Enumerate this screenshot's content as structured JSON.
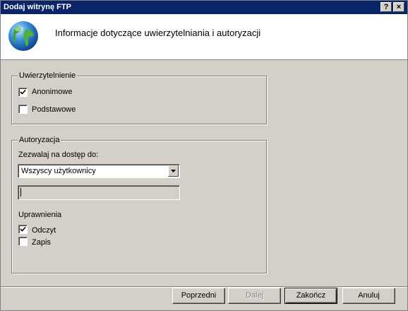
{
  "window": {
    "title": "Dodaj witrynę FTP",
    "help_label": "?",
    "close_label": "×"
  },
  "header": {
    "title": "Informacje dotyczące uwierzytelniania i autoryzacji",
    "icon": "globe-icon"
  },
  "authentication": {
    "legend": "Uwierzytelnienie",
    "anonymous": {
      "label": "Anonimowe",
      "checked": true
    },
    "basic": {
      "label": "Podstawowe",
      "checked": false
    }
  },
  "authorization": {
    "legend": "Autoryzacja",
    "allow_label": "Zezwalaj na dostęp do:",
    "allow_value": "Wszyscy użytkownicy",
    "user_field_value": "",
    "permissions_label": "Uprawnienia",
    "read": {
      "label": "Odczyt",
      "checked": true
    },
    "write": {
      "label": "Zapis",
      "checked": false
    }
  },
  "buttons": {
    "previous": "Poprzedni",
    "next": "Dalej",
    "finish": "Zakończ",
    "cancel": "Anuluj"
  },
  "colors": {
    "titlebar": "#0a246a",
    "face": "#d4d0c8"
  }
}
